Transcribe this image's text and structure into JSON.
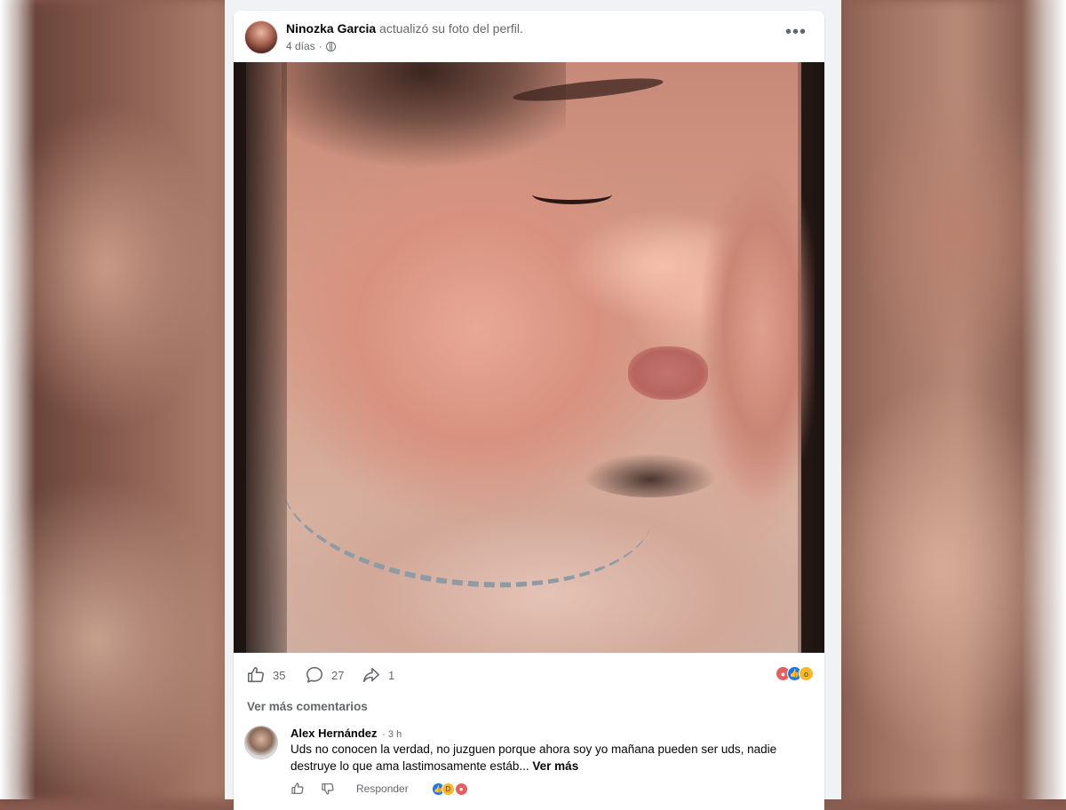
{
  "post": {
    "author": "Ninozka Garcia",
    "action": " actualizó su foto del perfil.",
    "time": "4 días",
    "separator": "·",
    "more_label": "•••"
  },
  "stats": {
    "likes": "35",
    "comments": "27",
    "shares": "1"
  },
  "comments_section": {
    "see_more": "Ver más comentarios",
    "items": [
      {
        "author": "Alex Hernández",
        "time": "· 3 h",
        "text": "Uds no conocen la verdad, no juzguen porque ahora soy yo mañana pueden ser uds, nadie destruye lo que ama lastimosamente estáb... ",
        "see_more": "Ver más",
        "reply_label": "Responder"
      }
    ]
  },
  "icons": {
    "avatar": "avatar-photo",
    "globe": "globe-icon",
    "more": "more-options-icon",
    "like": "thumbs-up-icon",
    "comment": "comment-bubble-icon",
    "share": "share-arrow-icon",
    "dislike": "thumbs-down-icon",
    "reactions": [
      "angry-reaction",
      "like-reaction",
      "wow-reaction"
    ],
    "comment_reactions": [
      "like-reaction",
      "haha-reaction",
      "angry-reaction"
    ]
  },
  "colors": {
    "link_blue": "#1877f2",
    "secondary_text": "#65676b",
    "panel_bg": "#f0f2f5"
  }
}
